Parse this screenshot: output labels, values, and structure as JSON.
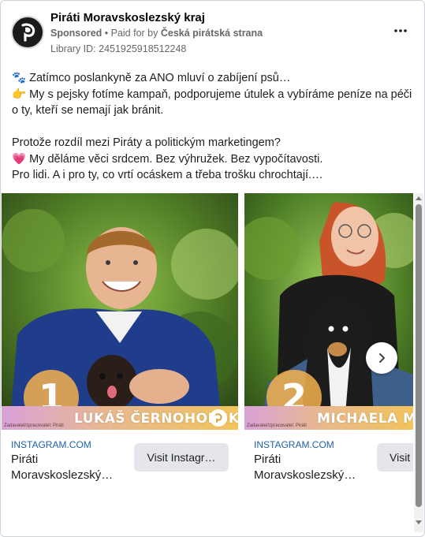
{
  "header": {
    "page_name": "Piráti Moravskoslezský kraj",
    "sponsored": "Sponsored",
    "paid_for_prefix": " • Paid for by ",
    "payer": "Česká pirátská strana",
    "library_id": "Library ID: 2451925918512248",
    "more_icon": "more-dots-icon"
  },
  "post": {
    "line1": "🐾 Zatímco poslankyně za ANO mluví o zabíjení psů…",
    "line2": "👉 My s pejsky fotíme kampaň, podporujeme útulek a vybíráme peníze na péči o ty, kteří se nemají jak bránit.",
    "line3": "Protože rozdíl mezi Piráty a politickým marketingem?",
    "line4": "💗 My děláme věci srdcem. Bez výhružek. Bez vypočítavosti.",
    "line5": "Pro lidi. A i pro ty, co vrtí ocáskem a třeba trošku chrochtají.…"
  },
  "carousel": {
    "slides": [
      {
        "number": "1",
        "name": "LUKÁŠ ČERNOHORSKÝ",
        "note": "Zadavatel/zpracovatel: Piráti",
        "domain": "INSTAGRAM.COM",
        "headline": "Piráti Moravskoslezský…",
        "cta": "Visit Instagr…"
      },
      {
        "number": "2",
        "name": "MICHAELA MORICOV",
        "note": "Zadavatel/zpracovatel: Piráti",
        "domain": "INSTAGRAM.COM",
        "headline": "Piráti Moravskoslezský…",
        "cta": "Visit"
      }
    ],
    "next_icon": "chevron-right-icon"
  },
  "colors": {
    "link_blue": "#1f5fa8",
    "cta_bg": "#e4e6eb",
    "banner_start": "#d9a2d8",
    "banner_end": "#f1c45b"
  }
}
